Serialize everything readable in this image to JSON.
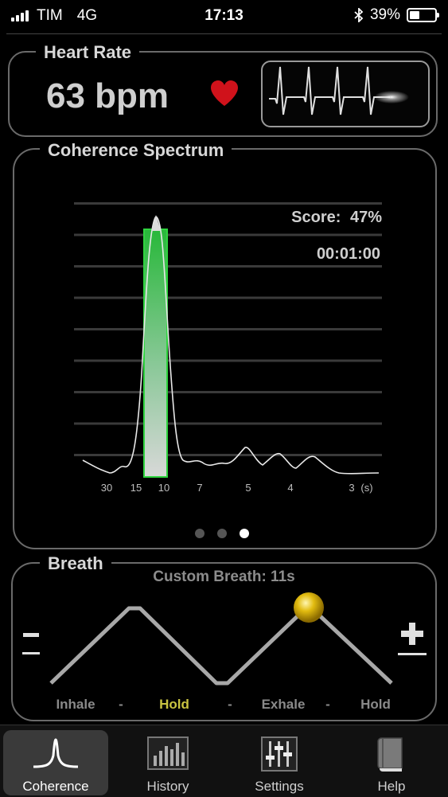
{
  "status_bar": {
    "carrier": "TIM",
    "network": "4G",
    "time": "17:13",
    "battery": "39%",
    "battery_level": 0.39
  },
  "heart_rate": {
    "title": "Heart Rate",
    "value": "63 bpm",
    "heart_color": "#d0121b"
  },
  "spectrum": {
    "title": "Coherence Spectrum",
    "score_label": "Score:",
    "score_value": "47%",
    "timer": "00:01:00",
    "ticks": [
      "30",
      "15",
      "10",
      "7",
      "5",
      "4",
      "3",
      "(s)"
    ],
    "accent": "#2fc23a"
  },
  "pager": {
    "count": 3,
    "active_index": 2
  },
  "breath": {
    "title": "Breath",
    "custom_label": "Custom Breath: 11s",
    "phases": [
      "Inhale",
      "-",
      "Hold",
      "-",
      "Exhale",
      "-",
      "Hold"
    ],
    "active_phase": "Hold",
    "minus_icon": "minus-icon",
    "plus_icon": "plus-icon"
  },
  "tabs": [
    {
      "label": "Coherence",
      "icon": "coherence-peak-icon",
      "active": true
    },
    {
      "label": "History",
      "icon": "bar-chart-icon",
      "active": false
    },
    {
      "label": "Settings",
      "icon": "sliders-icon",
      "active": false
    },
    {
      "label": "Help",
      "icon": "book-icon",
      "active": false
    }
  ]
}
